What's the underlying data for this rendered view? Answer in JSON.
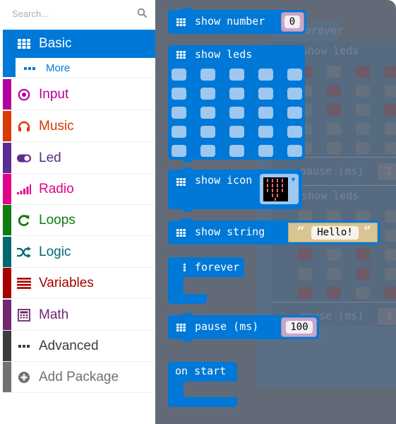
{
  "search": {
    "placeholder": "Search...",
    "icon": "search-icon"
  },
  "categories": [
    {
      "id": "basic",
      "label": "Basic",
      "icon": "grid-icon",
      "color": "#0078d7",
      "selected": true
    },
    {
      "id": "more",
      "label": "More",
      "icon": "ellipsis-icon",
      "color": "#0078d7"
    },
    {
      "id": "input",
      "label": "Input",
      "icon": "target-icon",
      "color": "#b4009e"
    },
    {
      "id": "music",
      "label": "Music",
      "icon": "headphones-icon",
      "color": "#d83b01"
    },
    {
      "id": "led",
      "label": "Led",
      "icon": "toggle-icon",
      "color": "#5c2d91"
    },
    {
      "id": "radio",
      "label": "Radio",
      "icon": "signal-icon",
      "color": "#e3008c"
    },
    {
      "id": "loops",
      "label": "Loops",
      "icon": "refresh-icon",
      "color": "#107c10"
    },
    {
      "id": "logic",
      "label": "Logic",
      "icon": "shuffle-icon",
      "color": "#006970"
    },
    {
      "id": "variables",
      "label": "Variables",
      "icon": "list-icon",
      "color": "#a80000"
    },
    {
      "id": "math",
      "label": "Math",
      "icon": "calculator-icon",
      "color": "#712672"
    },
    {
      "id": "advanced",
      "label": "Advanced",
      "icon": "ellipsis-icon",
      "color": "#3c3c3c"
    },
    {
      "id": "addpkg",
      "label": "Add Package",
      "icon": "plus-circle-icon",
      "color": "#717171"
    }
  ],
  "flyout": {
    "show_number": {
      "label": "show number",
      "value": "0"
    },
    "show_leds": {
      "label": "show leds",
      "leds": [
        [
          0,
          0,
          0,
          0,
          0
        ],
        [
          0,
          0,
          0,
          0,
          0
        ],
        [
          0,
          0,
          0,
          0,
          0
        ],
        [
          0,
          0,
          0,
          0,
          0
        ],
        [
          0,
          0,
          0,
          0,
          0
        ]
      ]
    },
    "show_icon": {
      "label": "show icon",
      "icon_value": "heart",
      "caret": "▼"
    },
    "show_string": {
      "label": "show string",
      "value": "Hello!",
      "open_quote": "“",
      "close_quote": "”"
    },
    "forever": {
      "label": "forever"
    },
    "pause": {
      "label": "pause (ms)",
      "value": "100"
    },
    "on_start": {
      "label": "on start"
    }
  },
  "background_program": {
    "forever_label": "forever",
    "show_leds_label": "show leds",
    "pause_label": "pause (ms)",
    "pause_value": "1",
    "leds_1": [
      [
        1,
        0,
        1,
        1
      ],
      [
        0,
        1,
        0,
        0
      ],
      [
        0,
        1,
        0,
        1
      ],
      [
        0,
        0,
        0,
        0
      ],
      [
        0,
        0,
        0,
        0
      ]
    ],
    "leds_2": [
      [
        0,
        0,
        0,
        0
      ],
      [
        0,
        0,
        0,
        0
      ],
      [
        1,
        0,
        1,
        0
      ],
      [
        0,
        0,
        1,
        0
      ],
      [
        1,
        1,
        0,
        1
      ]
    ]
  }
}
